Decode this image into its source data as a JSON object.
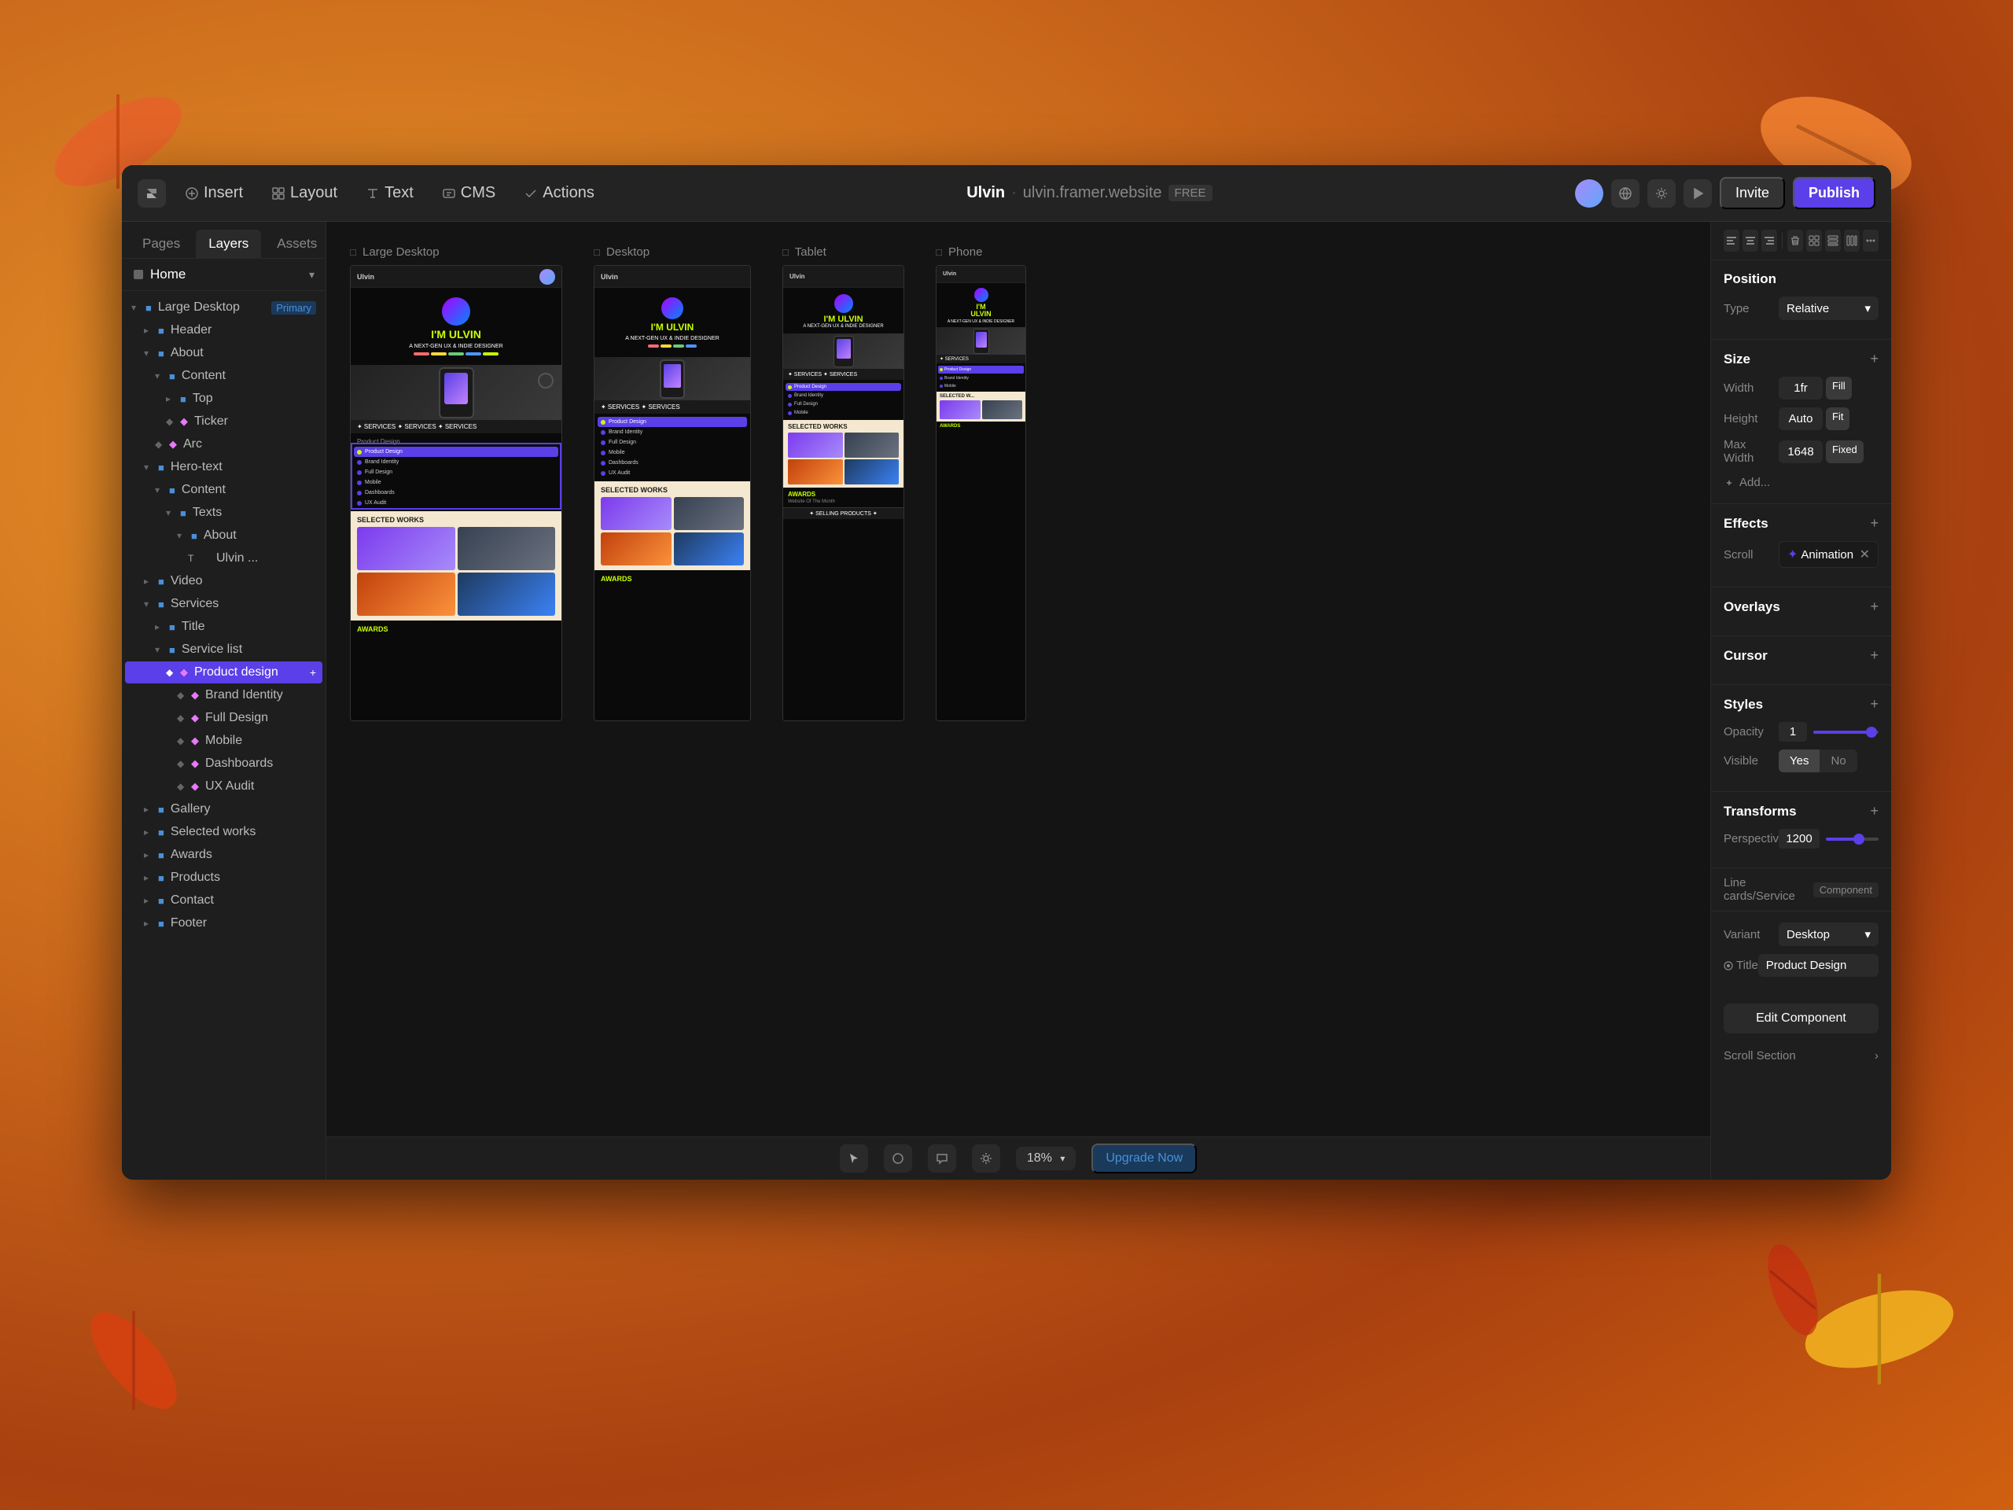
{
  "app": {
    "title": "Ulvin",
    "url": "ulvin.framer.website",
    "plan": "FREE"
  },
  "toolbar": {
    "insert_label": "Insert",
    "layout_label": "Layout",
    "text_label": "Text",
    "cms_label": "CMS",
    "actions_label": "Actions",
    "invite_label": "Invite",
    "publish_label": "Publish"
  },
  "left_panel": {
    "tabs": [
      "Pages",
      "Layers",
      "Assets"
    ],
    "active_tab": "Layers",
    "page": "Home",
    "layers": [
      {
        "id": "large-desktop",
        "name": "Large Desktop",
        "indent": 0,
        "type": "frame",
        "badge": "Primary",
        "expanded": true
      },
      {
        "id": "header",
        "name": "Header",
        "indent": 1,
        "type": "component",
        "badge": ""
      },
      {
        "id": "about",
        "name": "About",
        "indent": 1,
        "type": "frame",
        "badge": ""
      },
      {
        "id": "content",
        "name": "Content",
        "indent": 2,
        "type": "frame",
        "badge": ""
      },
      {
        "id": "top",
        "name": "Top",
        "indent": 3,
        "type": "frame",
        "badge": ""
      },
      {
        "id": "ticker",
        "name": "Ticker",
        "indent": 3,
        "type": "component",
        "badge": ""
      },
      {
        "id": "arc",
        "name": "Arc",
        "indent": 2,
        "type": "shape",
        "badge": ""
      },
      {
        "id": "hero-text",
        "name": "Hero-text",
        "indent": 1,
        "type": "frame",
        "badge": ""
      },
      {
        "id": "content2",
        "name": "Content",
        "indent": 2,
        "type": "frame",
        "badge": ""
      },
      {
        "id": "texts",
        "name": "Texts",
        "indent": 3,
        "type": "frame",
        "badge": ""
      },
      {
        "id": "about2",
        "name": "About",
        "indent": 4,
        "type": "frame",
        "badge": ""
      },
      {
        "id": "ulvin",
        "name": "Ulvin ...",
        "indent": 5,
        "type": "text",
        "badge": ""
      },
      {
        "id": "video",
        "name": "Video",
        "indent": 1,
        "type": "frame",
        "badge": ""
      },
      {
        "id": "services",
        "name": "Services",
        "indent": 1,
        "type": "frame",
        "badge": ""
      },
      {
        "id": "title",
        "name": "Title",
        "indent": 2,
        "type": "component",
        "badge": ""
      },
      {
        "id": "service-list",
        "name": "Service list",
        "indent": 2,
        "type": "frame",
        "badge": ""
      },
      {
        "id": "product-design",
        "name": "Product design",
        "indent": 3,
        "type": "component",
        "badge": "",
        "active": true
      },
      {
        "id": "brand-identity",
        "name": "Brand Identity",
        "indent": 4,
        "type": "component",
        "badge": ""
      },
      {
        "id": "full-design",
        "name": "Full Design",
        "indent": 4,
        "type": "component",
        "badge": ""
      },
      {
        "id": "mobile",
        "name": "Mobile",
        "indent": 4,
        "type": "component",
        "badge": ""
      },
      {
        "id": "dashboards",
        "name": "Dashboards",
        "indent": 4,
        "type": "component",
        "badge": ""
      },
      {
        "id": "ux-audit",
        "name": "UX Audit",
        "indent": 4,
        "type": "component",
        "badge": ""
      },
      {
        "id": "gallery",
        "name": "Gallery",
        "indent": 1,
        "type": "frame",
        "badge": ""
      },
      {
        "id": "selected-works",
        "name": "Selected works",
        "indent": 1,
        "type": "frame",
        "badge": ""
      },
      {
        "id": "awards",
        "name": "Awards",
        "indent": 1,
        "type": "frame",
        "badge": ""
      },
      {
        "id": "products",
        "name": "Products",
        "indent": 1,
        "type": "frame",
        "badge": ""
      },
      {
        "id": "contact",
        "name": "Contact",
        "indent": 1,
        "type": "frame",
        "badge": ""
      },
      {
        "id": "footer",
        "name": "Footer",
        "indent": 1,
        "type": "component",
        "badge": ""
      }
    ]
  },
  "canvas": {
    "frames": [
      {
        "id": "large-desktop",
        "label": "Large Desktop",
        "size": "large"
      },
      {
        "id": "desktop",
        "label": "Desktop",
        "size": "desktop"
      },
      {
        "id": "tablet",
        "label": "Tablet",
        "size": "tablet"
      },
      {
        "id": "phone",
        "label": "Phone",
        "size": "phone"
      }
    ],
    "zoom": "18%"
  },
  "right_panel": {
    "position": {
      "title": "Position",
      "type_label": "Type",
      "type_value": "Relative"
    },
    "size": {
      "title": "Size",
      "width_label": "Width",
      "width_value": "1fr",
      "width_mode": "Fill",
      "height_label": "Height",
      "height_value": "Auto",
      "height_mode": "Fit",
      "max_width_label": "Max Width",
      "max_width_value": "1648",
      "max_width_mode": "Fixed",
      "add_label": "Add..."
    },
    "effects": {
      "title": "Effects",
      "scroll_label": "Scroll",
      "animation_label": "Animation"
    },
    "overlays": {
      "title": "Overlays"
    },
    "cursor": {
      "title": "Cursor"
    },
    "styles": {
      "title": "Styles",
      "opacity_label": "Opacity",
      "opacity_value": "1",
      "visible_label": "Visible",
      "yes_label": "Yes",
      "no_label": "No"
    },
    "transforms": {
      "title": "Transforms",
      "perspective_label": "Perspective",
      "perspective_value": "1200"
    },
    "component": {
      "title": "Line cards/Service",
      "badge": "Component",
      "variant_label": "Variant",
      "variant_value": "Desktop",
      "title_label": "Title",
      "title_value": "Product Design",
      "edit_btn": "Edit Component"
    },
    "scroll_section": {
      "label": "Scroll Section"
    }
  },
  "bottom_toolbar": {
    "zoom": "18%",
    "upgrade_btn": "Upgrade Now"
  }
}
